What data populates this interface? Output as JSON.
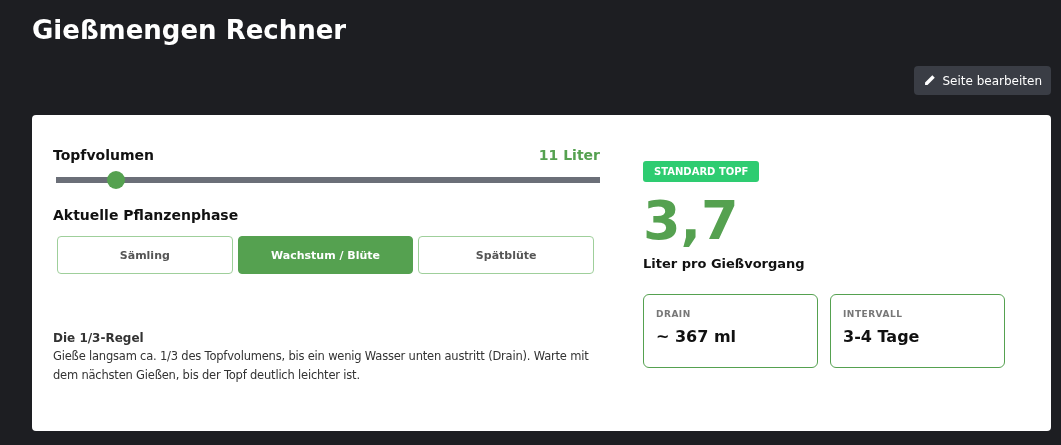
{
  "page": {
    "title": "Gießmengen Rechner",
    "edit_button": "Seite bearbeiten"
  },
  "volume": {
    "label": "Topfvolumen",
    "reading": "11 Liter",
    "level": 0.11
  },
  "phase": {
    "label": "Aktuelle Pflanzenphase",
    "options": [
      {
        "label": "Sämling",
        "selected": false
      },
      {
        "label": "Wachstum / Blüte",
        "selected": true
      },
      {
        "label": "Spätblüte",
        "selected": false
      }
    ]
  },
  "rule": {
    "title": "Die 1/3-Regel",
    "text": "Gieße langsam ca. 1/3 des Topfvolumens, bis ein wenig Wasser unten austritt (Drain). Warte mit dem nächsten Gießen, bis der Topf deutlich leichter ist."
  },
  "result": {
    "badge": "STANDARD TOPF",
    "value": "3,7",
    "unit": "Liter pro Gießvorgang",
    "stats": [
      {
        "label": "DRAIN",
        "value": "~ 367 ml"
      },
      {
        "label": "INTERVALL",
        "value": "3-4 Tage"
      }
    ]
  }
}
